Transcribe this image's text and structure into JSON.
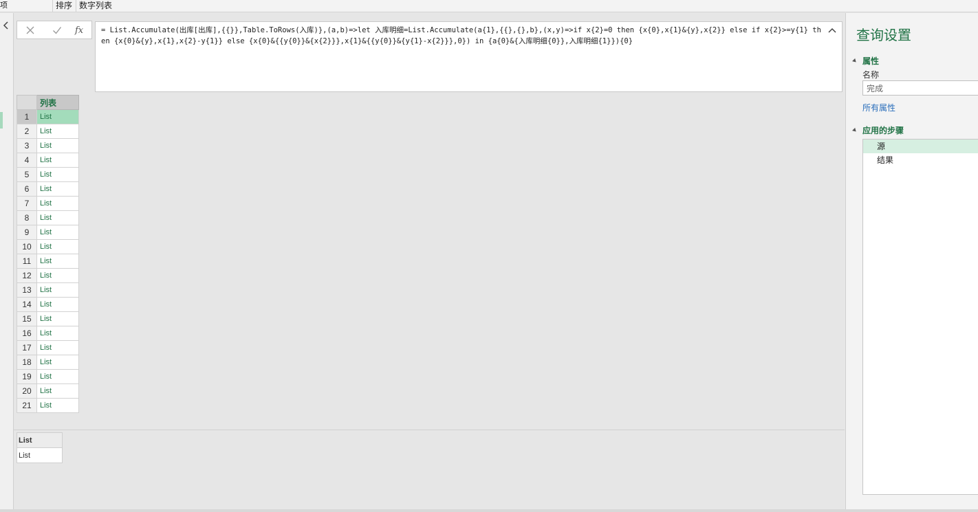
{
  "ribbon": {
    "stub": "项",
    "sort": "排序",
    "numlist": "数字列表"
  },
  "formula_bar": {
    "text": "= List.Accumulate(出库[出库],{{}},Table.ToRows(入库)},(a,b)=>let 入库明细=List.Accumulate(a{1},{{},{},b},(x,y)=>if x{2}=0 then {x{0},x{1}&{y},x{2}} else if x{2}>=y{1} then {x{0}&{y},x{1},x{2}-y{1}} else {x{0}&{{y{0}}&{x{2}}},x{1}&{{y{0}}&{y{1}-x{2}}},0}) in {a{0}&{入库明细{0}},入库明细{1}}){0}"
  },
  "grid": {
    "column_header": "列表",
    "selected_row": 1,
    "rows": [
      {
        "n": "1",
        "v": "List"
      },
      {
        "n": "2",
        "v": "List"
      },
      {
        "n": "3",
        "v": "List"
      },
      {
        "n": "4",
        "v": "List"
      },
      {
        "n": "5",
        "v": "List"
      },
      {
        "n": "6",
        "v": "List"
      },
      {
        "n": "7",
        "v": "List"
      },
      {
        "n": "8",
        "v": "List"
      },
      {
        "n": "9",
        "v": "List"
      },
      {
        "n": "10",
        "v": "List"
      },
      {
        "n": "11",
        "v": "List"
      },
      {
        "n": "12",
        "v": "List"
      },
      {
        "n": "13",
        "v": "List"
      },
      {
        "n": "14",
        "v": "List"
      },
      {
        "n": "15",
        "v": "List"
      },
      {
        "n": "16",
        "v": "List"
      },
      {
        "n": "17",
        "v": "List"
      },
      {
        "n": "18",
        "v": "List"
      },
      {
        "n": "19",
        "v": "List"
      },
      {
        "n": "20",
        "v": "List"
      },
      {
        "n": "21",
        "v": "List"
      }
    ]
  },
  "preview": {
    "header": "List",
    "value": "List"
  },
  "query_settings": {
    "title": "查询设置",
    "properties_heading": "属性",
    "name_label": "名称",
    "name_value": "完成",
    "all_properties": "所有属性",
    "applied_steps_heading": "应用的步骤",
    "steps": [
      "源",
      "结果"
    ],
    "active_step": 0
  },
  "colors": {
    "accent": "#217346",
    "selected_cell": "#a3dcbb",
    "link": "#2a6ebb",
    "active_step": "#d6efe1"
  }
}
